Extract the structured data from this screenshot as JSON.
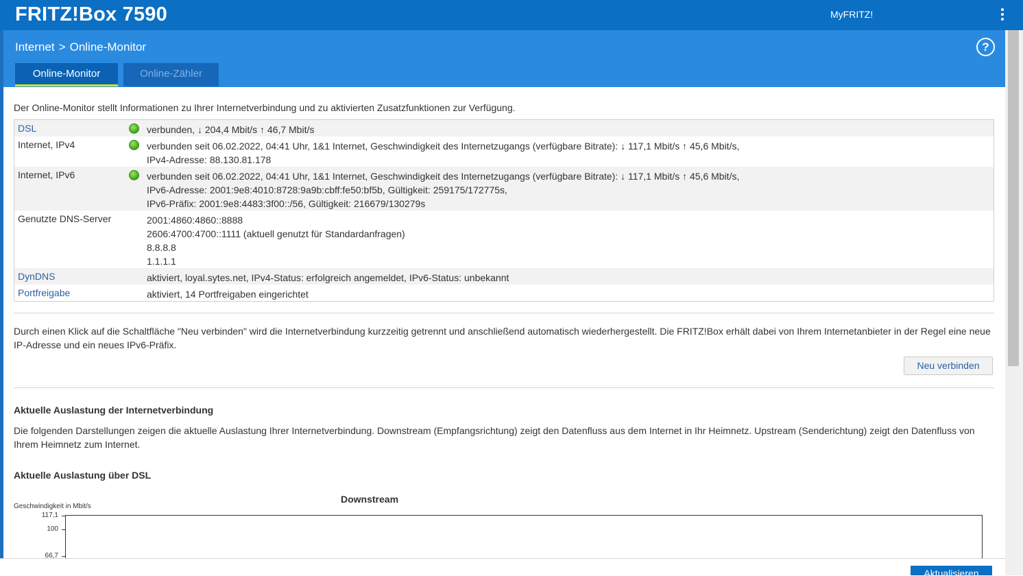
{
  "header": {
    "brand": "FRITZ!Box 7590",
    "myfritz_label": "MyFRITZ!",
    "menu_icon": "kebab-menu-icon"
  },
  "breadcrumb": {
    "parent": "Internet",
    "separator": ">",
    "current": "Online-Monitor",
    "help_icon": "help-icon",
    "help_glyph": "?"
  },
  "tabs": [
    {
      "label": "Online-Monitor",
      "active": true
    },
    {
      "label": "Online-Zähler",
      "active": false
    }
  ],
  "intro": "Der Online-Monitor stellt Informationen zu Ihrer Internetverbindung und zu aktivierten Zusatzfunktionen zur Verfügung.",
  "status_rows": [
    {
      "label": "DSL",
      "link": true,
      "status": "green",
      "lines": [
        "verbunden, ↓ 204,4 Mbit/s ↑ 46,7 Mbit/s"
      ]
    },
    {
      "label": "Internet, IPv4",
      "link": false,
      "status": "green",
      "lines": [
        "verbunden seit 06.02.2022, 04:41 Uhr, 1&1 Internet, Geschwindigkeit des Internetzugangs (verfügbare Bitrate): ↓ 117,1 Mbit/s ↑ 45,6 Mbit/s,",
        "IPv4-Adresse: 88.130.81.178"
      ]
    },
    {
      "label": "Internet, IPv6",
      "link": false,
      "status": "green",
      "lines": [
        "verbunden seit 06.02.2022, 04:41 Uhr, 1&1 Internet, Geschwindigkeit des Internetzugangs (verfügbare Bitrate): ↓ 117,1 Mbit/s ↑ 45,6 Mbit/s,",
        "IPv6-Adresse: 2001:9e8:4010:8728:9a9b:cbff:fe50:bf5b, Gültigkeit: 259175/172775s,",
        "IPv6-Präfix: 2001:9e8:4483:3f00::/56, Gültigkeit: 216679/130279s"
      ]
    },
    {
      "label": "Genutzte DNS-Server",
      "link": false,
      "status": null,
      "lines": [
        "2001:4860:4860::8888",
        "2606:4700:4700::1111 (aktuell genutzt für Standardanfragen)",
        "8.8.8.8",
        "1.1.1.1"
      ]
    },
    {
      "label": "DynDNS",
      "link": true,
      "status": null,
      "lines": [
        "aktiviert, loyal.sytes.net, IPv4-Status: erfolgreich angemeldet, IPv6-Status: unbekannt"
      ]
    },
    {
      "label": "Portfreigabe",
      "link": true,
      "status": null,
      "lines": [
        "aktiviert, 14 Portfreigaben eingerichtet"
      ]
    }
  ],
  "reconnect": {
    "text": "Durch einen Klick auf die Schaltfläche \"Neu verbinden\" wird die Internetverbindung kurzzeitig getrennt und anschließend automatisch wiederhergestellt. Die FRITZ!Box erhält dabei von Ihrem Internetanbieter in der Regel eine neue IP-Adresse und ein neues IPv6-Präfix.",
    "button": "Neu verbinden"
  },
  "load": {
    "heading": "Aktuelle Auslastung der Internetverbindung",
    "text": "Die folgenden Darstellungen zeigen die aktuelle Auslastung Ihrer Internetverbindung. Downstream (Empfangsrichtung) zeigt den Datenfluss aus dem Internet in Ihr Heimnetz. Upstream (Senderichtung) zeigt den Datenfluss von Ihrem Heimnetz zum Internet.",
    "dsl_heading": "Aktuelle Auslastung über DSL"
  },
  "chart": {
    "title": "Downstream",
    "ylabel": "Geschwindigkeit in Mbit/s",
    "yticks": [
      "117,1",
      "100",
      "66,7"
    ]
  },
  "footer": {
    "refresh_button": "Aktualisieren"
  }
}
